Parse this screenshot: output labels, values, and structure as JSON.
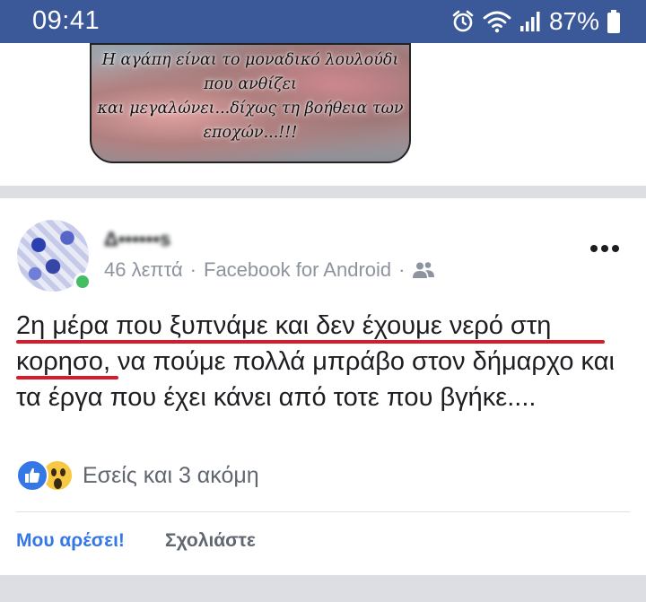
{
  "status_bar": {
    "time": "09:41",
    "battery": "87%",
    "icons": [
      "alarm-icon",
      "wifi-icon",
      "signal-icon",
      "battery-icon"
    ]
  },
  "image_post": {
    "quote_lines": [
      "Η αγάπη είναι το μοναδικό λουλούδι",
      "που ανθίζει",
      "και μεγαλώνει...δίχως τη βοήθεια των",
      "εποχών...!!!"
    ]
  },
  "post": {
    "author": "Δ••••••s",
    "time": "46 λεπτά",
    "separator": "·",
    "source": "Facebook for Android",
    "audience_icon": "friends-icon",
    "text_part1": "2η μέρα που ξυπνάμε και δεν έχουμε νερό στη κορησο",
    "text_part2": ", να πούμε πολλά μπράβο στον δήμαρχο και τα έργα που έχει κάνει από τοτε που βγήκε....",
    "reactions": {
      "icons": [
        "like-icon",
        "wow-icon"
      ],
      "summary": "Εσείς και 3 ακόμη"
    },
    "actions": {
      "like": "Μου αρέσει!",
      "comment": "Σχολιάστε"
    }
  },
  "colors": {
    "header_bg": "#3b5998",
    "like_blue": "#3578e5",
    "underline_red": "#d81b2c",
    "meta_gray": "#8d949e"
  }
}
